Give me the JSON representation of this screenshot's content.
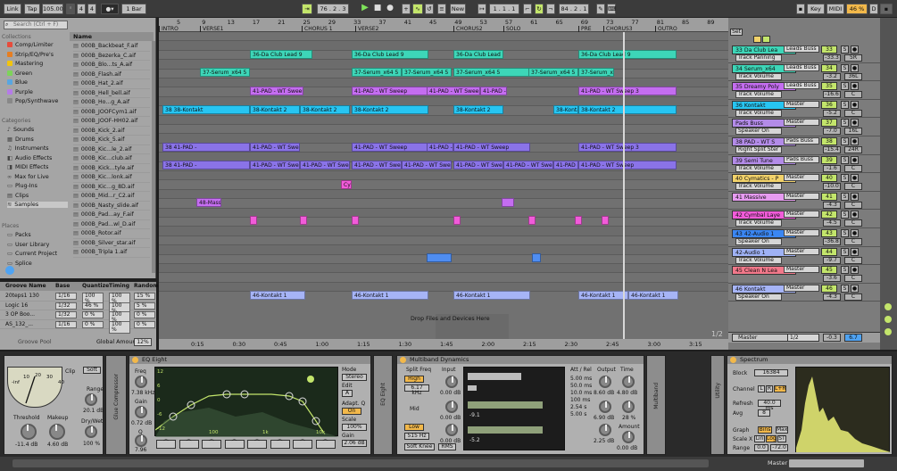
{
  "transport": {
    "link": "Link",
    "tap": "Tap",
    "tempo": "105.00",
    "sig_num": "4",
    "sig_den": "4",
    "quant": "1 Bar",
    "position": "76 . 2 . 3",
    "new": "New",
    "loop_start": "1 . 1 . 1",
    "loop_len": "84 . 2 . 1",
    "key": "Key",
    "midi": "MIDI",
    "cpu": "46 %",
    "d_label": "D"
  },
  "browser": {
    "search_placeholder": "Search (Ctrl + F)",
    "collections_label": "Collections",
    "collections": [
      "Comp/Limiter",
      "Strip/EQ/Pre's",
      "Mastering",
      "Green",
      "Blue",
      "Purple",
      "Pop/Synthwave"
    ],
    "collection_colors": [
      "#e74c3c",
      "#e67e22",
      "#f1c40f",
      "#7dd35a",
      "#58a6e0",
      "#b57be8",
      "#888888"
    ],
    "categories_label": "Categories",
    "categories": [
      "Sounds",
      "Drums",
      "Instruments",
      "Audio Effects",
      "MIDI Effects",
      "Max for Live",
      "Plug-Ins",
      "Clips",
      "Samples"
    ],
    "places_label": "Places",
    "places": [
      "Packs",
      "User Library",
      "Current Project",
      "Splice"
    ],
    "name_header": "Name",
    "files": [
      "000B_Backbeat_F.aif",
      "000B_Bezerka_C.aif",
      "000B_Blo...ts_A.aif",
      "000B_Flash.aif",
      "000B_Hat_2.aif",
      "000B_Hell_bell.aif",
      "000B_Ho...g_A.aif",
      "000B_JOOFCym1.aif",
      "000B_JOOF-HH02.aif",
      "000B_Kick_2.aif",
      "000B_Kick_5.aif",
      "000B_Kic...le_2.aif",
      "000B_Kic...club.aif",
      "000B_Kick...tyle.aif",
      "000B_Kic...lonk.aif",
      "000B_Kic...g_8D.aif",
      "000B_Mid...r_C2.aif",
      "000B_Nasty_slide.aif",
      "000B_Pad...ay_F.aif",
      "000B_Pad...wl_D.aif",
      "000B_Rotor.aif",
      "000B_Silver_star.aif",
      "000B_Tripla 1.aif"
    ]
  },
  "groove": {
    "headers": [
      "Groove Name",
      "Base",
      "Quantize",
      "Timing",
      "Random"
    ],
    "rows": [
      [
        "20teps1 130",
        "1/16",
        "100 %",
        "100 %",
        "15 %"
      ],
      [
        "Logic 16",
        "1/32",
        "46 %",
        "100 %",
        "5 %"
      ],
      [
        "3 OP Boo...",
        "1/32",
        "0 %",
        "100 %",
        "0 %"
      ],
      [
        "AS_132_...",
        "1/16",
        "0 %",
        "100 %",
        "0 %"
      ]
    ],
    "pool": "Groove Pool",
    "global_label": "Global Amount",
    "global_value": "12%"
  },
  "ruler": {
    "bars": [
      "5",
      "9",
      "13",
      "17",
      "21",
      "25",
      "29",
      "33",
      "37",
      "41",
      "45",
      "49",
      "53",
      "57",
      "61",
      "65",
      "69",
      "73",
      "77",
      "81",
      "85",
      "89"
    ],
    "locators": [
      "INTRO",
      "VERSE1",
      "CHORUS 1",
      "VERSE2",
      "CHORUS2",
      "SOLO",
      "PRE",
      "CHORUS3",
      "OUTRO"
    ],
    "times": [
      "0:15",
      "0:30",
      "0:45",
      "1:00",
      "1:15",
      "1:30",
      "1:45",
      "2:00",
      "2:15",
      "2:30",
      "2:45",
      "3:00",
      "3:15"
    ],
    "page": "1/2",
    "drop_hint": "Drop Files and Devices Here"
  },
  "clips": {
    "club_lead": "36-Da Club Lead 9",
    "serum": "37-Serum_x64 5",
    "pad_sweep": "41-PAD - WT Sweep",
    "pad_sweep3": "41-PAD - WT Sweep 3",
    "kontakt": "38-Kontakt 2",
    "kontakt_short": "38 38-Kontakt",
    "pad_short": "38 41-PAD -",
    "massive": "48-Massive",
    "cym": "Cym",
    "kontakt1": "46-Kontakt 1"
  },
  "tracks": [
    {
      "name": "33 Da Club Lea",
      "color": "#3dd6b8",
      "route": "Leads Buss",
      "sub": "Track Panning",
      "num": "33",
      "vol": "-33.3",
      "pan": "5R"
    },
    {
      "name": "34 Serum_x64",
      "color": "#3dd6b8",
      "route": "Leads Buss",
      "sub": "Track Volume",
      "num": "34",
      "vol": "-3.2",
      "pan": "36L"
    },
    {
      "name": "35 Dreamy Poly",
      "color": "#c46df0",
      "route": "Leads Buss",
      "sub": "Track Volume",
      "num": "35",
      "vol": "-16.6",
      "pan": "C"
    },
    {
      "name": "36 Kontakt",
      "color": "#27c5f2",
      "route": "Master",
      "sub": "Track Volume",
      "num": "36",
      "vol": "-5.2",
      "pan": "C"
    },
    {
      "name": "Pads Buss",
      "color": "#b38be8",
      "route": "Master",
      "sub": "Speaker On",
      "num": "37",
      "vol": "-7.0",
      "pan": "16L"
    },
    {
      "name": "38 PAD - WT S",
      "color": "#b38be8",
      "route": "Pads Buss",
      "sub": "Right Split Ster",
      "num": "38",
      "vol": "-15.4",
      "pan": "24R"
    },
    {
      "name": "39 Semi Tune",
      "color": "#b38be8",
      "route": "Pads Buss",
      "sub": "Track Volume",
      "num": "39",
      "vol": "-1.6",
      "pan": "C"
    },
    {
      "name": "40 Cymatics - P",
      "color": "#f2d26a",
      "route": "Master",
      "sub": "Track Volume",
      "num": "40",
      "vol": "-10.0",
      "pan": "C"
    },
    {
      "name": "41 Massive",
      "color": "#e69bf0",
      "route": "Master",
      "sub": "",
      "num": "41",
      "vol": "-4.3",
      "pan": "C"
    },
    {
      "name": "42 Cymbal Laye",
      "color": "#f15bd9",
      "route": "Master",
      "sub": "Track Volume",
      "num": "42",
      "vol": "-4.5",
      "pan": "C"
    },
    {
      "name": "43 42-Audio 1",
      "color": "#3a86f2",
      "route": "Master",
      "sub": "Speaker On",
      "num": "43",
      "vol": "-36.8",
      "pan": "C"
    },
    {
      "name": "42-Audio 1",
      "color": "#9fb2f5",
      "route": "Master",
      "sub": "Track Volume",
      "num": "44",
      "vol": "-9.7",
      "pan": "C"
    },
    {
      "name": "45 Clean N Lea",
      "color": "#f2788a",
      "route": "Master",
      "sub": "",
      "num": "45",
      "vol": "-3.6",
      "pan": "C"
    },
    {
      "name": "46 Kontakt",
      "color": "#a6b4f7",
      "route": "Master",
      "sub": "Speaker On",
      "num": "46",
      "vol": "-4.3",
      "pan": "C"
    }
  ],
  "master": {
    "name": "Master",
    "route": "1/2",
    "vol": "-0.3",
    "pan": "6.7",
    "set": "Set"
  },
  "compressor": {
    "clip": "Clip",
    "soft": "Soft",
    "threshold_label": "Threshold",
    "threshold": "-11.4 dB",
    "makeup_label": "Makeup",
    "makeup": "4.60 dB",
    "range_label": "Range",
    "range": "20.1 dB",
    "drywet_label": "Dry/Wet",
    "drywet": "100 %",
    "scale": [
      "-inf",
      "10",
      "20",
      "30",
      "40"
    ],
    "side_label": "Glue Compressor"
  },
  "eq": {
    "title": "EQ Eight",
    "freq_label": "Freq",
    "freq": "7.38 kHz",
    "gain_label": "Gain",
    "gain": "0.72 dB",
    "q_label": "Q",
    "q": "7.96",
    "mode_label": "Mode",
    "mode": "Stereo",
    "edit_label": "Edit",
    "edit": "A",
    "adapt_label": "Adapt. Q",
    "adapt": "On",
    "scale_label": "Scale",
    "scale": "100%",
    "out_gain_label": "Gain",
    "out_gain": "2.06 dB",
    "db_ticks": [
      "12",
      "6",
      "0",
      "-6",
      "-12"
    ],
    "freq_ticks": [
      "100",
      "1k",
      "10k"
    ],
    "side_label": "EQ Eight"
  },
  "mbd": {
    "title": "Multiband Dynamics",
    "split_label": "Split Freq",
    "input_label": "Input",
    "high": "High",
    "high_freq": "6.17 kHz",
    "high_in": "0.00 dB",
    "mid": "Mid",
    "mid_in": "0.00 dB",
    "low": "Low",
    "low_freq": "515 Hz",
    "low_in": "0.00 dB",
    "soft_knee": "Soft Knee",
    "rms": "RMS",
    "att_label": "Att / Rel",
    "att_vals": [
      "5.00 ms",
      "50.0 ms",
      "10.0 ms",
      "100 ms",
      "2.54 s",
      "5.00 s"
    ],
    "output_label": "Output",
    "out_high": "8.60 dB",
    "out_mid": "6.90 dB",
    "out_low": "2.25 dB",
    "time_label": "Time",
    "time": "4.80 dB",
    "time2": "28 %",
    "amount_label": "Amount",
    "amount": "0.00 dB",
    "gr1": "-9.1",
    "gr2": "-5.2",
    "side_label": "Multiband"
  },
  "spectrum": {
    "title": "Spectrum",
    "block_label": "Block",
    "block": "16384",
    "channel_label": "Channel",
    "ch_l": "L",
    "ch_r": "R",
    "ch_lr": "L+R",
    "refresh_label": "Refresh",
    "refresh": "40.0 ms",
    "avg_label": "Avg",
    "avg": "8",
    "graph_label": "Graph",
    "bins": "Bins",
    "max": "Max",
    "scalex_label": "Scale X",
    "lin": "Lin",
    "log": "Log",
    "st": "ST",
    "range_label": "Range",
    "range_lo": "0.0",
    "range_hi": "-72.0",
    "side_label": "Utility"
  },
  "status": {
    "master": "Master"
  }
}
